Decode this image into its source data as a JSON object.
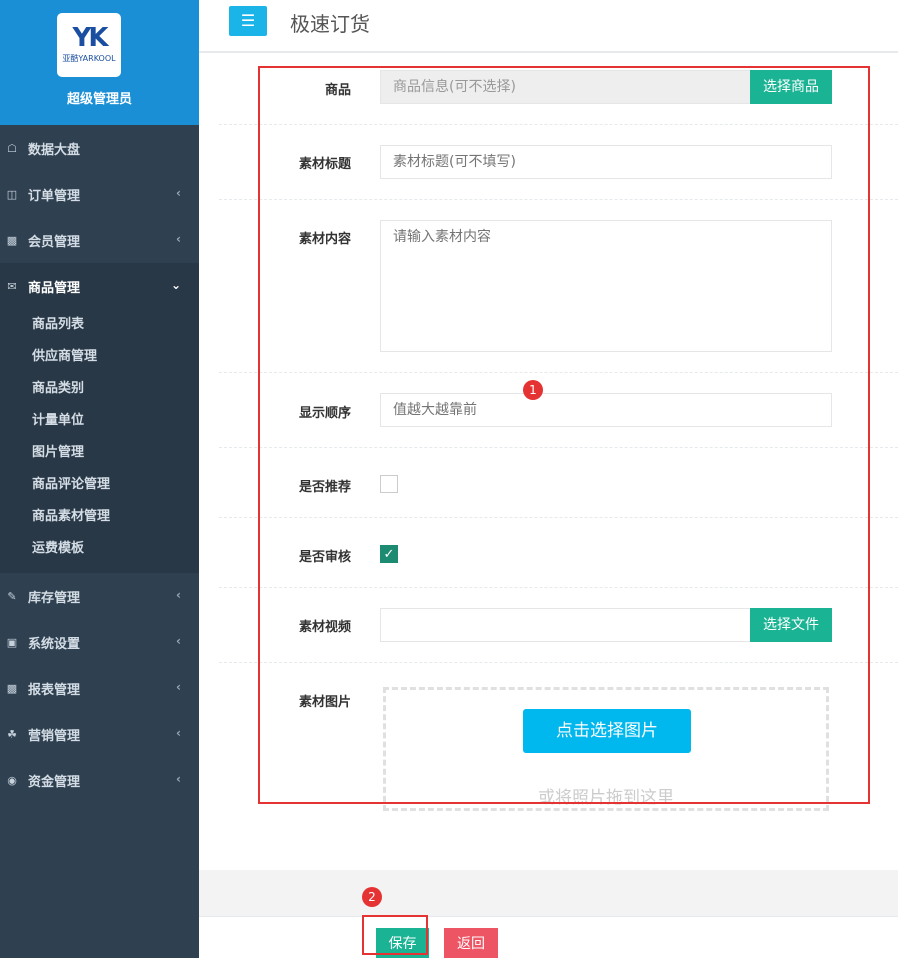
{
  "profile": {
    "logo_text": "YK",
    "logo_sub": "亚酷YARKOOL",
    "user_name": "超级管理员"
  },
  "nav": {
    "items": [
      {
        "label": "数据大盘",
        "icon": "home-icon"
      },
      {
        "label": "订单管理",
        "icon": "order-icon"
      },
      {
        "label": "会员管理",
        "icon": "member-chart-icon"
      },
      {
        "label": "商品管理",
        "icon": "envelope-icon"
      },
      {
        "label": "库存管理",
        "icon": "edit-icon"
      },
      {
        "label": "系统设置",
        "icon": "monitor-icon"
      },
      {
        "label": "报表管理",
        "icon": "bar-chart-icon"
      },
      {
        "label": "营销管理",
        "icon": "cutlery-icon"
      },
      {
        "label": "资金管理",
        "icon": "money-icon"
      }
    ],
    "sub_items": [
      "商品列表",
      "供应商管理",
      "商品类别",
      "计量单位",
      "图片管理",
      "商品评论管理",
      "商品素材管理",
      "运费模板"
    ]
  },
  "topbar": {
    "title": "极速订货"
  },
  "form": {
    "product": {
      "label": "商品",
      "placeholder": "商品信息(可不选择)",
      "button": "选择商品"
    },
    "title": {
      "label": "素材标题",
      "placeholder": "素材标题(可不填写)"
    },
    "content": {
      "label": "素材内容",
      "placeholder": "请输入素材内容"
    },
    "order": {
      "label": "显示顺序",
      "placeholder": "值越大越靠前"
    },
    "recommend": {
      "label": "是否推荐"
    },
    "audit": {
      "label": "是否审核"
    },
    "video": {
      "label": "素材视频",
      "button": "选择文件"
    },
    "images": {
      "label": "素材图片",
      "button": "点击选择图片",
      "hint": "或将照片拖到这里"
    }
  },
  "annotations": {
    "badge1": "1",
    "badge2": "2"
  },
  "footer": {
    "save": "保存",
    "back": "返回"
  }
}
